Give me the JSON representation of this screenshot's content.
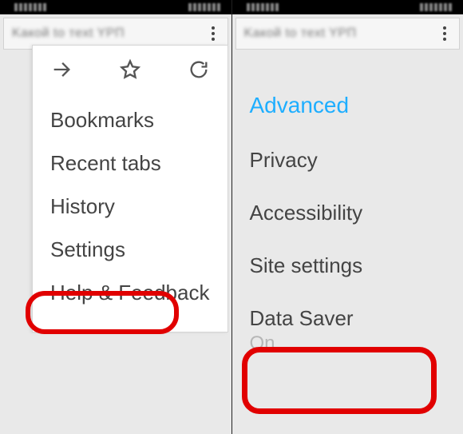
{
  "left": {
    "url_text": "Kакой to тext YPП",
    "menu": {
      "bookmarks": "Bookmarks",
      "recent_tabs": "Recent tabs",
      "history": "History",
      "settings": "Settings",
      "help_feedback": "Help & Feedback"
    }
  },
  "right": {
    "url_text": "Kакой to тext YPП",
    "section_title": "Advanced",
    "items": {
      "privacy": "Privacy",
      "accessibility": "Accessibility",
      "site_settings": "Site settings",
      "data_saver": {
        "label": "Data Saver",
        "status": "On"
      }
    }
  }
}
